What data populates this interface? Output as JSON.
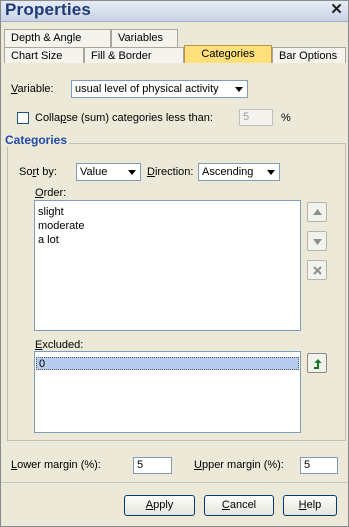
{
  "window": {
    "title": "Properties",
    "close_icon": "close-icon"
  },
  "tabs": {
    "row1": [
      {
        "label": "Depth & Angle"
      },
      {
        "label": "Variables"
      }
    ],
    "row2": [
      {
        "label": "Chart Size"
      },
      {
        "label": "Fill & Border"
      },
      {
        "label": "Categories",
        "active": true
      },
      {
        "label": "Bar Options"
      }
    ]
  },
  "variable": {
    "label": "Variable:",
    "value": "usual level of physical activity"
  },
  "collapse": {
    "label": "Collapse (sum) categories less than:",
    "value": "5",
    "unit": "%",
    "checked": false
  },
  "categories_group": {
    "title": "Categories",
    "sort_by": {
      "label": "Sort by:",
      "value": "Value"
    },
    "direction": {
      "label": "Direction:",
      "value": "Ascending"
    },
    "order": {
      "label": "Order:",
      "items": [
        "slight",
        "moderate",
        "a lot"
      ]
    },
    "excluded": {
      "label": "Excluded:",
      "items": [
        "0"
      ]
    }
  },
  "margins": {
    "lower": {
      "label": "Lower margin (%):",
      "value": "5"
    },
    "upper": {
      "label": "Upper margin (%):",
      "value": "5"
    }
  },
  "buttons": {
    "apply": "Apply",
    "cancel": "Cancel",
    "help": "Help"
  },
  "colors": {
    "accent_tab": "#ffe07a",
    "group_title": "#1f4aa8",
    "selection": "#b6cdf0",
    "title": "#1e3a78"
  }
}
